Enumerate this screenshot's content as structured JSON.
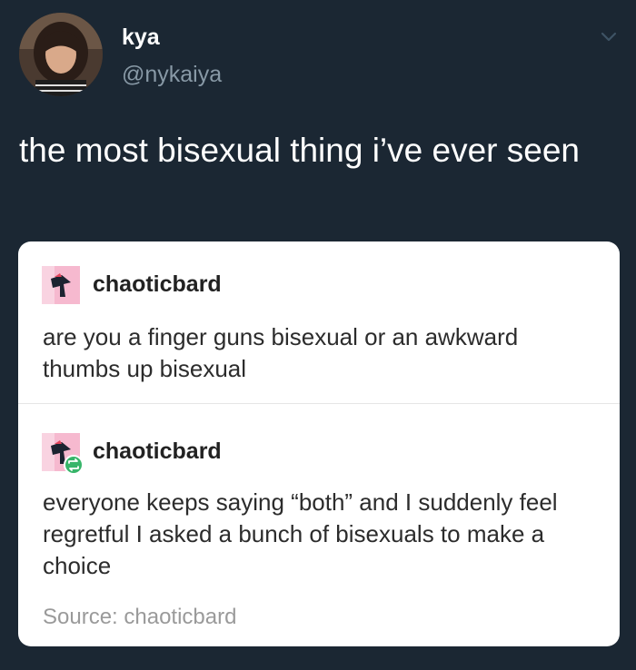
{
  "tweet": {
    "display_name": "kya",
    "handle": "@nykaiya",
    "text": "the most bisexual thing i’ve ever seen",
    "menu_icon": "chevron-down-icon"
  },
  "embedded_posts": {
    "posts": [
      {
        "username": "chaoticbard",
        "body": "are you a finger guns bisexual or an awkward thumbs up bisexual"
      },
      {
        "username": "chaoticbard",
        "body": "everyone keeps saying “both” and I suddenly feel regretful I asked a bunch of bisexuals to make a choice",
        "badge_icon": "reblog-icon"
      }
    ],
    "source": "Source: chaoticbard"
  },
  "colors": {
    "background": "#1b2733",
    "handle": "#8899a6",
    "card": "#ffffff",
    "reblog_badge": "#38b56a",
    "tumblr_avatar": "#f6b9cf"
  }
}
